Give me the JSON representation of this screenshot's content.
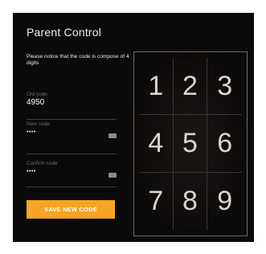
{
  "title": "Parent Control",
  "notice": "Please notice that the code is compose of 4 digits",
  "fields": {
    "old": {
      "label": "Old code",
      "value": "4950"
    },
    "new": {
      "label": "New code",
      "value": "••••"
    },
    "confirm": {
      "label": "Confirm code",
      "value": "••••"
    }
  },
  "save_label": "SAVE NEW CODE",
  "keypad": {
    "keys": [
      "1",
      "2",
      "3",
      "4",
      "5",
      "6",
      "7",
      "8",
      "9"
    ]
  },
  "colors": {
    "background": "#0b0a0a",
    "accent": "#f7a524",
    "keypad_border": "#7a6a55"
  }
}
